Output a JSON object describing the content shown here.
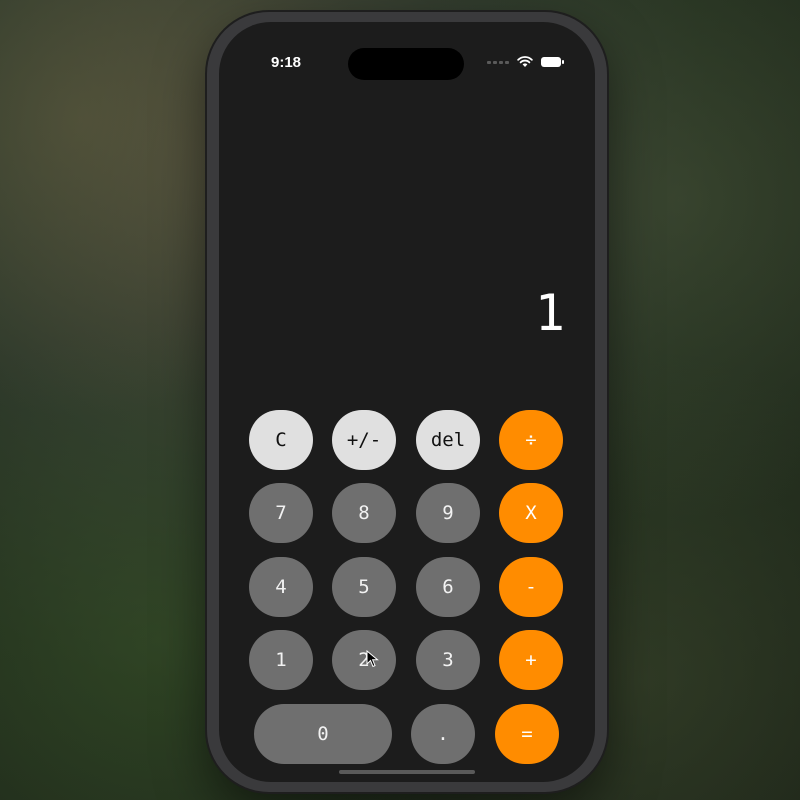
{
  "status_bar": {
    "time": "9:18"
  },
  "display": {
    "value": "1"
  },
  "keys": {
    "clear": "C",
    "sign": "+/-",
    "delete": "del",
    "divide": "÷",
    "seven": "7",
    "eight": "8",
    "nine": "9",
    "multiply": "X",
    "four": "4",
    "five": "5",
    "six": "6",
    "subtract": "-",
    "one": "1",
    "two": "2",
    "three": "3",
    "add": "+",
    "zero": "0",
    "decimal": ".",
    "equals": "="
  },
  "colors": {
    "accent_orange": "#ff8c00",
    "function_key": "#e0e0e0",
    "digit_key": "#6f6f6f",
    "screen_bg": "#1c1c1c"
  }
}
